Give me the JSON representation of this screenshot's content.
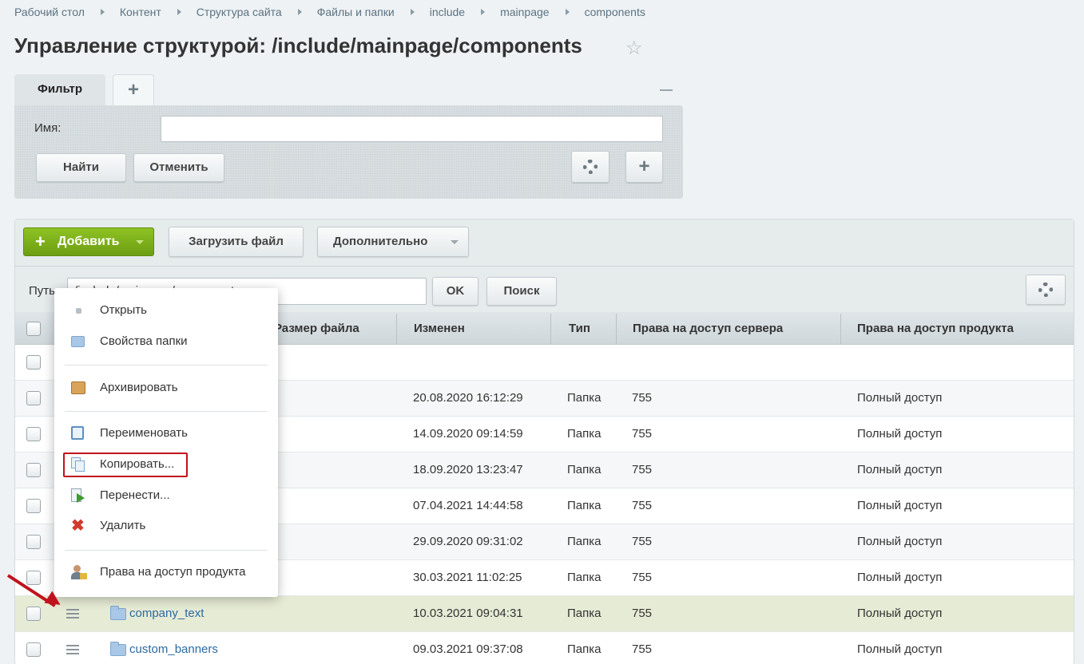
{
  "breadcrumb": [
    "Рабочий стол",
    "Контент",
    "Структура сайта",
    "Файлы и папки",
    "include",
    "mainpage",
    "components"
  ],
  "title": "Управление структурой: /include/mainpage/components",
  "filter": {
    "tab_label": "Фильтр",
    "add_tab": "+",
    "name_label": "Имя:",
    "name_value": "",
    "find_button": "Найти",
    "cancel_button": "Отменить"
  },
  "toolbar": {
    "add_button": "Добавить",
    "upload_button": "Загрузить файл",
    "more_button": "Дополнительно",
    "path_label": "Путь",
    "path_value": "/include/mainpage/components",
    "ok_button": "OK",
    "search_button": "Поиск"
  },
  "table": {
    "columns": [
      "Размер файла",
      "Изменен",
      "Тип",
      "Права на доступ сервера",
      "Права на доступ продукта"
    ],
    "rows": [
      {
        "name": "",
        "modified": "",
        "type": "",
        "server_rights": "",
        "product_rights": ""
      },
      {
        "name": "",
        "modified": "20.08.2020 16:12:29",
        "type": "Папка",
        "server_rights": "755",
        "product_rights": "Полный доступ"
      },
      {
        "name": "",
        "modified": "14.09.2020 09:14:59",
        "type": "Папка",
        "server_rights": "755",
        "product_rights": "Полный доступ"
      },
      {
        "name": "",
        "modified": "18.09.2020 13:23:47",
        "type": "Папка",
        "server_rights": "755",
        "product_rights": "Полный доступ"
      },
      {
        "name": "",
        "modified": "07.04.2021 14:44:58",
        "type": "Папка",
        "server_rights": "755",
        "product_rights": "Полный доступ"
      },
      {
        "name": "",
        "modified": "29.09.2020 09:31:02",
        "type": "Папка",
        "server_rights": "755",
        "product_rights": "Полный доступ"
      },
      {
        "name": "",
        "modified": "30.03.2021 11:02:25",
        "type": "Папка",
        "server_rights": "755",
        "product_rights": "Полный доступ"
      },
      {
        "name": "company_text",
        "modified": "10.03.2021 09:04:31",
        "type": "Папка",
        "server_rights": "755",
        "product_rights": "Полный доступ"
      },
      {
        "name": "custom_banners",
        "modified": "09.03.2021 09:37:08",
        "type": "Папка",
        "server_rights": "755",
        "product_rights": "Полный доступ"
      }
    ]
  },
  "context_menu": {
    "open": "Открыть",
    "folder_props": "Свойства папки",
    "archive": "Архивировать",
    "rename": "Переименовать",
    "copy": "Копировать...",
    "move": "Перенести...",
    "delete": "Удалить",
    "product_rights": "Права на доступ продукта"
  },
  "colors": {
    "accent_green": "#7ab01b",
    "highlight_red": "#c0121c",
    "link": "#2b6aa0"
  }
}
